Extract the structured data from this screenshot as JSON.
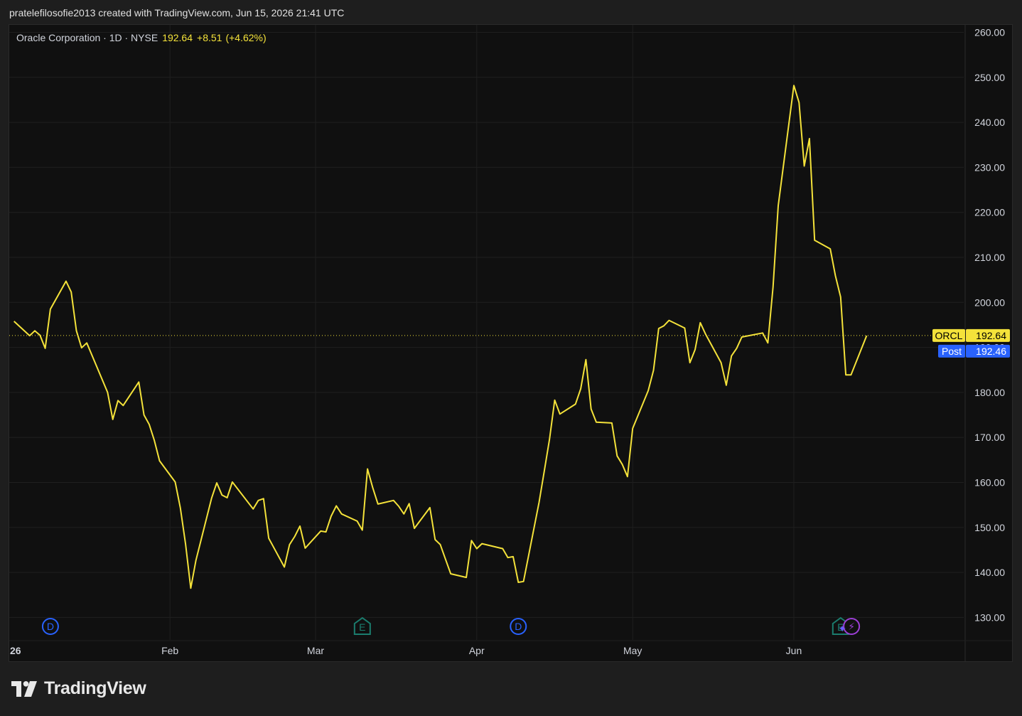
{
  "header": {
    "text": "pratelefilosofie2013 created with TradingView.com, Jun 15, 2026 21:41 UTC"
  },
  "legend": {
    "symbol": "Oracle Corporation · 1D · NYSE",
    "last": "192.64",
    "change": "+8.51",
    "change_pct": "(+4.62%)"
  },
  "price_labels": {
    "main_tag": "ORCL",
    "main_value": "192.64",
    "post_tag": "Post",
    "post_value": "192.46"
  },
  "colors": {
    "line": "#f4e23a",
    "background": "#101010",
    "grid": "#1f1f1f",
    "post_tag": "#2962ff",
    "dividend": "#2962ff",
    "earnings": "#1b7d6e",
    "split": "#9c3fd6"
  },
  "event_markers": [
    {
      "letter": "D",
      "kind": "dividend",
      "date": "2026-01-09"
    },
    {
      "letter": "E",
      "kind": "earnings",
      "date": "2026-03-10"
    },
    {
      "letter": "D",
      "kind": "dividend",
      "date": "2026-04-09"
    },
    {
      "letter": "E",
      "kind": "earnings",
      "date": "2026-06-10"
    },
    {
      "letter": "⚡",
      "kind": "split",
      "date": "2026-06-11"
    }
  ],
  "footer": {
    "brand": "TradingView"
  },
  "chart_data": {
    "type": "line",
    "series": [
      {
        "name": "ORCL",
        "x": [
          "2026-01-02",
          "2026-01-05",
          "2026-01-06",
          "2026-01-07",
          "2026-01-08",
          "2026-01-09",
          "2026-01-12",
          "2026-01-13",
          "2026-01-14",
          "2026-01-15",
          "2026-01-16",
          "2026-01-20",
          "2026-01-21",
          "2026-01-22",
          "2026-01-23",
          "2026-01-26",
          "2026-01-27",
          "2026-01-28",
          "2026-01-29",
          "2026-01-30",
          "2026-02-02",
          "2026-02-03",
          "2026-02-04",
          "2026-02-05",
          "2026-02-06",
          "2026-02-09",
          "2026-02-10",
          "2026-02-11",
          "2026-02-12",
          "2026-02-13",
          "2026-02-17",
          "2026-02-18",
          "2026-02-19",
          "2026-02-20",
          "2026-02-23",
          "2026-02-24",
          "2026-02-25",
          "2026-02-26",
          "2026-02-27",
          "2026-03-02",
          "2026-03-03",
          "2026-03-04",
          "2026-03-05",
          "2026-03-06",
          "2026-03-09",
          "2026-03-10",
          "2026-03-11",
          "2026-03-12",
          "2026-03-13",
          "2026-03-16",
          "2026-03-17",
          "2026-03-18",
          "2026-03-19",
          "2026-03-20",
          "2026-03-23",
          "2026-03-24",
          "2026-03-25",
          "2026-03-26",
          "2026-03-27",
          "2026-03-30",
          "2026-03-31",
          "2026-04-01",
          "2026-04-02",
          "2026-04-06",
          "2026-04-07",
          "2026-04-08",
          "2026-04-09",
          "2026-04-10",
          "2026-04-13",
          "2026-04-14",
          "2026-04-15",
          "2026-04-16",
          "2026-04-17",
          "2026-04-20",
          "2026-04-21",
          "2026-04-22",
          "2026-04-23",
          "2026-04-24",
          "2026-04-27",
          "2026-04-28",
          "2026-04-29",
          "2026-04-30",
          "2026-05-01",
          "2026-05-04",
          "2026-05-05",
          "2026-05-06",
          "2026-05-07",
          "2026-05-08",
          "2026-05-11",
          "2026-05-12",
          "2026-05-13",
          "2026-05-14",
          "2026-05-15",
          "2026-05-18",
          "2026-05-19",
          "2026-05-20",
          "2026-05-21",
          "2026-05-22",
          "2026-05-26",
          "2026-05-27",
          "2026-05-28",
          "2026-05-29",
          "2026-06-01",
          "2026-06-02",
          "2026-06-03",
          "2026-06-04",
          "2026-06-05",
          "2026-06-08",
          "2026-06-09",
          "2026-06-10",
          "2026-06-11",
          "2026-06-12",
          "2026-06-15"
        ],
        "values": [
          195.8,
          192.6,
          193.7,
          192.7,
          189.8,
          198.5,
          204.7,
          202.3,
          193.7,
          189.9,
          191.0,
          180.0,
          174.0,
          178.2,
          177.1,
          182.3,
          175.0,
          172.9,
          169.3,
          164.8,
          160.1,
          154.3,
          146.3,
          136.5,
          142.7,
          156.5,
          159.9,
          157.2,
          156.6,
          160.1,
          154.1,
          156.0,
          156.4,
          147.6,
          141.2,
          146.2,
          148.0,
          150.3,
          145.4,
          149.2,
          149.0,
          152.5,
          154.8,
          153.0,
          151.4,
          149.4,
          163.0,
          158.8,
          155.2,
          156.0,
          154.7,
          153.0,
          155.3,
          149.8,
          154.4,
          147.3,
          146.2,
          142.9,
          139.7,
          138.9,
          147.1,
          145.3,
          146.4,
          145.3,
          143.3,
          143.5,
          137.8,
          138.0,
          155.6,
          162.5,
          169.6,
          178.3,
          175.2,
          177.4,
          180.8,
          187.3,
          176.3,
          173.4,
          173.2,
          165.9,
          164.0,
          161.3,
          172.0,
          180.4,
          184.9,
          194.2,
          194.8,
          196.0,
          194.3,
          186.6,
          189.5,
          195.5,
          193.0,
          186.6,
          181.6,
          188.1,
          189.8,
          192.3,
          193.2,
          191.0,
          203.4,
          221.5,
          248.2,
          244.4,
          230.3,
          236.4,
          213.8,
          211.9,
          205.9,
          201.2,
          183.9,
          183.9,
          192.6
        ]
      }
    ],
    "y_ticks": [
      "260.00",
      "250.00",
      "240.00",
      "230.00",
      "220.00",
      "210.00",
      "200.00",
      "190.00",
      "180.00",
      "170.00",
      "160.00",
      "150.00",
      "140.00",
      "130.00"
    ],
    "x_ticks": [
      "26",
      "Feb",
      "Mar",
      "Apr",
      "May",
      "Jun"
    ],
    "x_tick_dates": [
      "2026-01-01",
      "2026-02-01",
      "2026-03-01",
      "2026-04-01",
      "2026-05-01",
      "2026-06-01"
    ],
    "ylim": [
      125,
      261
    ],
    "xlim": [
      "2026-01-01",
      "2026-07-01"
    ],
    "grid": true
  }
}
